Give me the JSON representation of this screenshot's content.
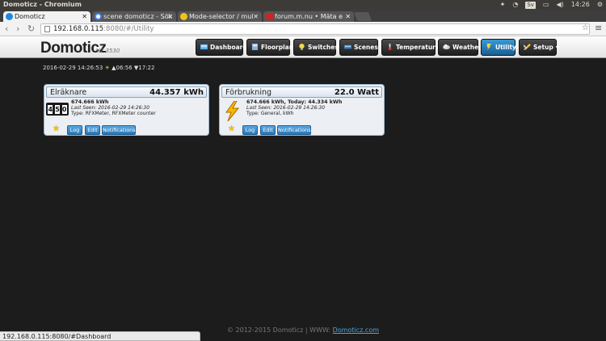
{
  "os": {
    "window_title": "Domoticz - Chromium",
    "keyboard_layout": "Sv",
    "clock": "14:26"
  },
  "browser": {
    "tabs": [
      {
        "label": "Domoticz",
        "icon": "domoticz-icon",
        "color": "#1e88e5"
      },
      {
        "label": "scene domoticz - Sök",
        "icon": "google-icon",
        "color": "#4285f4"
      },
      {
        "label": "Mode-selector / mul",
        "icon": "bulb-icon",
        "color": "#f0c419"
      },
      {
        "label": "forum.m.nu • Mäta e",
        "icon": "m-icon",
        "color": "#c62828"
      }
    ],
    "url_host": "192.168.0.115",
    "url_path": ":8080/#/Utility",
    "status_url": "192.168.0.115:8080/#Dashboard"
  },
  "app": {
    "logo": "Domoticz",
    "version": "V2.3530",
    "nav": [
      {
        "label": "Dashboard",
        "icon": "dashboard-icon"
      },
      {
        "label": "Floorplan",
        "icon": "floorplan-icon"
      },
      {
        "label": "Switches",
        "icon": "bulb-icon"
      },
      {
        "label": "Scenes",
        "icon": "scenes-icon"
      },
      {
        "label": "Temperature",
        "icon": "thermometer-icon"
      },
      {
        "label": "Weather",
        "icon": "cloud-icon"
      },
      {
        "label": "Utility",
        "icon": "utility-icon",
        "active": true
      },
      {
        "label": "Setup",
        "icon": "tools-icon",
        "dropdown": true
      }
    ],
    "datetime": "2016-02-29 14:26:53",
    "sunrise": "▲06:56",
    "sunset": "▼17:22"
  },
  "cards": [
    {
      "name": "Elräknare",
      "value": "44.357 kWh",
      "icon": "counter-icon",
      "digits": [
        "4",
        "5",
        "0"
      ],
      "line1": "674.666 kWh",
      "last_seen": "Last Seen: 2016-02-29 14:26:30",
      "type": "Type: RFXMeter, RFXMeter counter",
      "buttons": [
        "Log",
        "Edit",
        "Notifications"
      ]
    },
    {
      "name": "Förbrukning",
      "value": "22.0 Watt",
      "icon": "lightning-icon",
      "line1": "674.666 kWh, Today: 44.334 kWh",
      "last_seen": "Last Seen: 2016-02-29 14:26:30",
      "type": "Type: General, kWh",
      "buttons": [
        "Log",
        "Edit",
        "Notifications"
      ]
    }
  ],
  "footer": {
    "text": "© 2012-2015 Domoticz | WWW:",
    "link": "Domoticz.com"
  }
}
